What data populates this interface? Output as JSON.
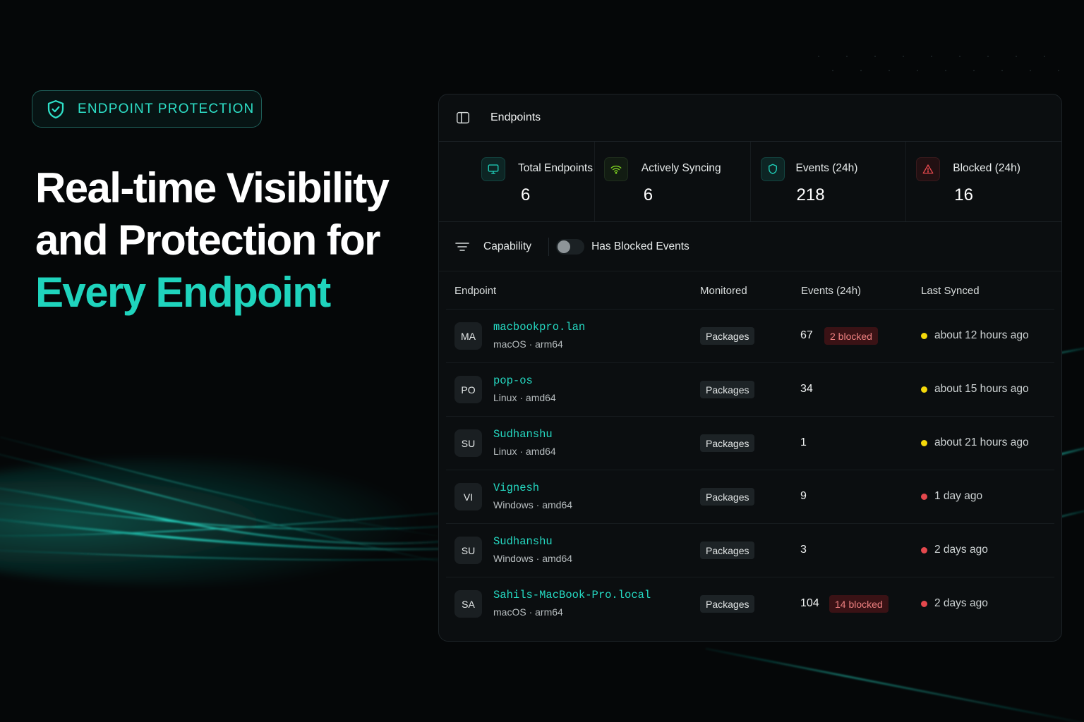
{
  "hero": {
    "badge_label": "ENDPOINT PROTECTION",
    "headline_line1": "Real-time Visibility",
    "headline_line2": "and Protection for",
    "headline_line3": "Every Endpoint"
  },
  "panel": {
    "title": "Endpoints",
    "stats": [
      {
        "label": "Total Endpoints",
        "value": "6",
        "icon": "monitor-icon",
        "color": "#1fd4bd"
      },
      {
        "label": "Actively Syncing",
        "value": "6",
        "icon": "wifi-icon",
        "color": "#7ed321"
      },
      {
        "label": "Events (24h)",
        "value": "218",
        "icon": "shield-icon",
        "color": "#1fd4bd"
      },
      {
        "label": "Blocked (24h)",
        "value": "16",
        "icon": "warning-icon",
        "color": "#e5484d"
      }
    ],
    "filters": {
      "capability_label": "Capability",
      "toggle_label": "Has Blocked Events",
      "toggle_on": false
    },
    "columns": [
      "Endpoint",
      "Monitored",
      "Events (24h)",
      "Last Synced"
    ],
    "rows": [
      {
        "initials": "MA",
        "name": "macbookpro.lan",
        "os": "macOS · arm64",
        "monitored": "Packages",
        "events": "67",
        "blocked": "2 blocked",
        "synced": "about 12 hours ago",
        "status": "warning"
      },
      {
        "initials": "PO",
        "name": "pop-os",
        "os": "Linux · amd64",
        "monitored": "Packages",
        "events": "34",
        "blocked": "",
        "synced": "about 15 hours ago",
        "status": "warning"
      },
      {
        "initials": "SU",
        "name": "Sudhanshu",
        "os": "Linux · amd64",
        "monitored": "Packages",
        "events": "1",
        "blocked": "",
        "synced": "about 21 hours ago",
        "status": "warning"
      },
      {
        "initials": "VI",
        "name": "Vignesh",
        "os": "Windows · amd64",
        "monitored": "Packages",
        "events": "9",
        "blocked": "",
        "synced": "1 day ago",
        "status": "stale"
      },
      {
        "initials": "SU",
        "name": "Sudhanshu",
        "os": "Windows · amd64",
        "monitored": "Packages",
        "events": "3",
        "blocked": "",
        "synced": "2 days ago",
        "status": "stale"
      },
      {
        "initials": "SA",
        "name": "Sahils-MacBook-Pro.local",
        "os": "macOS · arm64",
        "monitored": "Packages",
        "events": "104",
        "blocked": "14 blocked",
        "synced": "2 days ago",
        "status": "stale"
      }
    ],
    "status_colors": {
      "warning": "#f5d90a",
      "stale": "#e5484d"
    }
  },
  "colors": {
    "accent": "#1fd4bd",
    "background": "#050708",
    "panel": "#0b0e10"
  }
}
